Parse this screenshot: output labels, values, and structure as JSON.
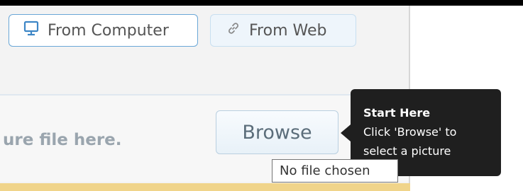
{
  "tabs": [
    {
      "label": "From Computer",
      "icon": "monitor-icon"
    },
    {
      "label": "From Web",
      "icon": "link-icon"
    }
  ],
  "drop_zone": {
    "text": "ure file here."
  },
  "browse_button": {
    "label": "Browse"
  },
  "file_tooltip": {
    "text": "No file chosen"
  },
  "callout": {
    "title": "Start Here",
    "body": "Click 'Browse' to select a picture"
  },
  "colors": {
    "accent_border": "#6aa7d7",
    "callout_bg": "#1f1f1f",
    "icon_blue": "#3d86c6"
  }
}
